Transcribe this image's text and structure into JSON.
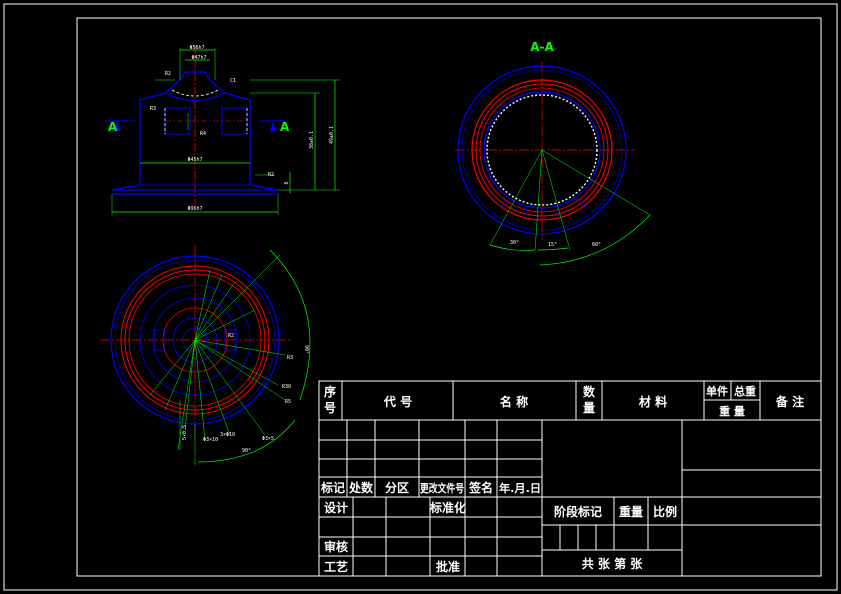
{
  "views": {
    "section_label": "A-A",
    "cut_mark_left": "A",
    "cut_mark_right": "A"
  },
  "dimensions": {
    "top_width_outer": "Φ56h7",
    "top_width_inner": "Φ47h7",
    "left_small_1": "R2",
    "left_small_2": "R3",
    "left_small_3": "R4",
    "right_small_1": "C1",
    "height_total": "49±0.1",
    "height_body": "38±0.1",
    "base_height": "6",
    "base_right_note": "R2",
    "inner_width": "Φ45h7",
    "base_width": "Φ96h7",
    "angle_left": "30°",
    "angle_mid": "15°",
    "angle_right": "60°",
    "plan_angle": "90°",
    "plan_r1": "R3",
    "plan_r2": "R30",
    "plan_r3": "R5",
    "plan_left_note": "5×0.5",
    "plan_note_2": "Φ3×10",
    "plan_note_3": "3×Φ10",
    "plan_note_4": "Φ3×5",
    "plan_bottom_angle": "90°",
    "plan_center_note": "R2"
  },
  "title_block": {
    "header": {
      "seq": "序号",
      "code": "代   号",
      "name": "名   称",
      "qty": "数量",
      "material": "材   料",
      "unit_w": "单件",
      "total_w": "总重",
      "weight": "重   量",
      "remark": "备 注"
    },
    "rev_row": {
      "mark": "标记",
      "count": "处数",
      "zone": "分区",
      "doc": "更改文件号",
      "sign": "签名",
      "date": "年.月.日"
    },
    "design": "设计",
    "standard": "标准化",
    "stage": "阶段标记",
    "weight2": "重量",
    "scale": "比例",
    "review": "审核",
    "process": "工艺",
    "approve": "批准",
    "sheets": "共   张   第   张"
  },
  "colors": {
    "background": "#000000",
    "frame": "#ffffff",
    "outline": "#0000ff",
    "dimension": "#00ff00",
    "center": "#ff0000",
    "hidden": "#ffffff"
  }
}
